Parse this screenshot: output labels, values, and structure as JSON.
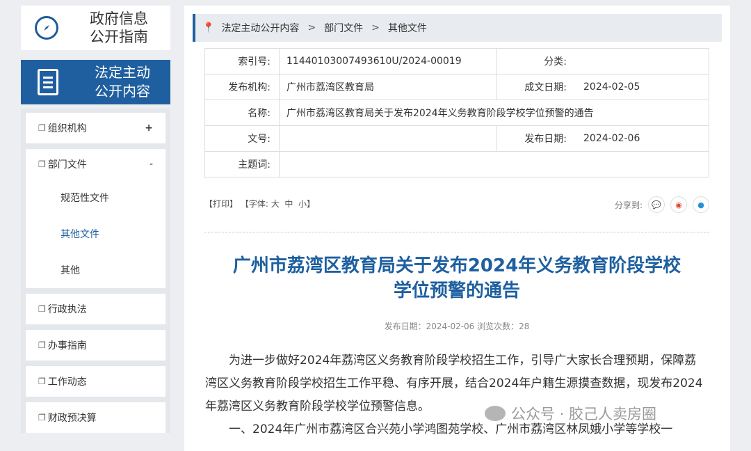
{
  "sidebar": {
    "guide_title_1": "政府信息",
    "guide_title_2": "公开指南",
    "active_title_1": "法定主动",
    "active_title_2": "公开内容",
    "items": {
      "org": "组织机构",
      "dept": "部门文件",
      "dept_subs": [
        "规范性文件",
        "其他文件",
        "其他"
      ],
      "enforce": "行政执法",
      "service": "办事指南",
      "work": "工作动态",
      "finance": "财政预决算"
    },
    "plus": "+",
    "minus": "-"
  },
  "breadcrumb": [
    "法定主动公开内容",
    "部门文件",
    "其他文件"
  ],
  "meta": {
    "index_label": "索引号:",
    "index_value": "11440103007493610U/2024-00019",
    "category_label": "分类:",
    "category_value": "",
    "issuer_label": "发布机构:",
    "issuer_value": "广州市荔湾区教育局",
    "created_label": "成文日期:",
    "created_value": "2024-02-05",
    "name_label": "名称:",
    "name_value": "广州市荔湾区教育局关于发布2024年义务教育阶段学校学位预警的通告",
    "docno_label": "文号:",
    "docno_value": "",
    "pubdate_label": "发布日期:",
    "pubdate_value": "2024-02-06",
    "subject_label": "主题词:",
    "subject_value": ""
  },
  "tools": {
    "print": "【打印】",
    "font": "【字体:",
    "big": "大",
    "mid": "中",
    "small": "小】",
    "share_label": "分享到:"
  },
  "article": {
    "title_line1": "广州市荔湾区教育局关于发布2024年义务教育阶段学校",
    "title_line2": "学位预警的通告",
    "pubinfo": "发布日期：2024-02-06  浏览次数：28",
    "para1": "为进一步做好2024年荔湾区义务教育阶段学校招生工作，引导广大家长合理预期，保障荔湾区义务教育阶段学校招生工作平稳、有序开展，结合2024年户籍生源摸查数据，现发布2024年荔湾区义务教育阶段学校学位预警信息。",
    "para2": "一、2024年广州市荔湾区合兴苑小学鸿图苑学校、广州市荔湾区林凤娥小学等学校一"
  },
  "watermark": "公众号 · 胶己人卖房圈",
  "colors": {
    "primary": "#1f5f9f",
    "title": "#1e5fa0"
  }
}
